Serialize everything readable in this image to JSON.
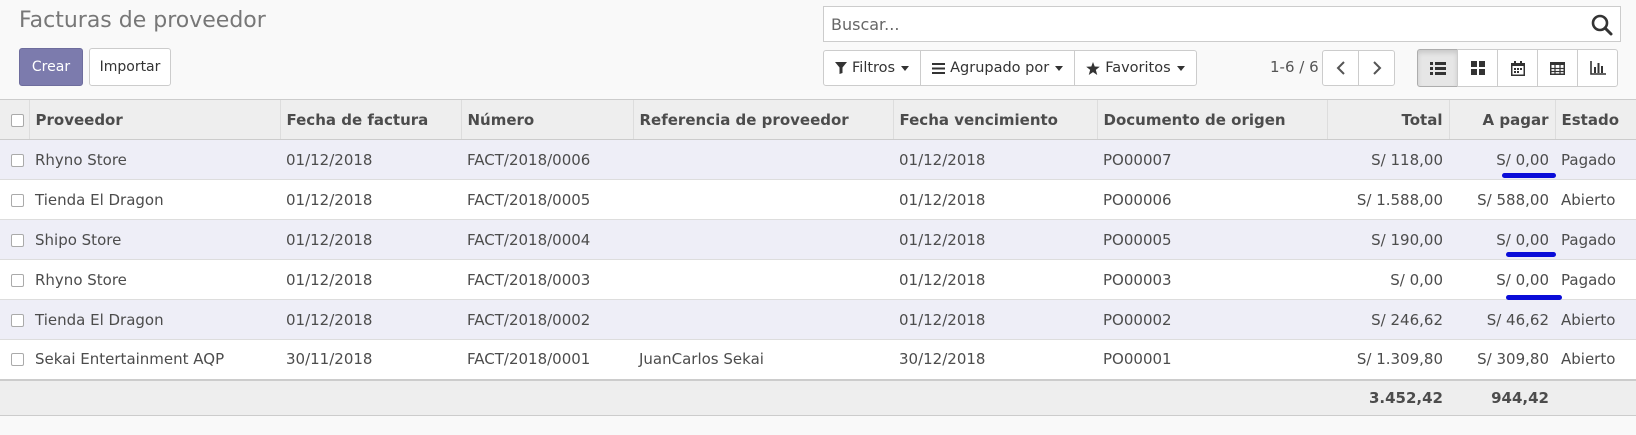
{
  "page": {
    "title": "Facturas de proveedor"
  },
  "buttons": {
    "create": "Crear",
    "import": "Importar"
  },
  "search": {
    "placeholder": "Buscar..."
  },
  "filters": {
    "filter": "Filtros",
    "group_by": "Agrupado por",
    "favorites": "Favoritos"
  },
  "pager": {
    "value": "1-6 / 6"
  },
  "views": [
    "list-view",
    "kanban-view",
    "calendar-view",
    "pivot-view",
    "graph-view"
  ],
  "table": {
    "columns": [
      "Proveedor",
      "Fecha de factura",
      "Número",
      "Referencia de proveedor",
      "Fecha vencimiento",
      "Documento de origen",
      "Total",
      "A pagar",
      "Estado"
    ],
    "rows": [
      [
        "Rhyno Store",
        "01/12/2018",
        "FACT/2018/0006",
        "",
        "01/12/2018",
        "PO00007",
        "S/ 118,00",
        "S/ 0,00",
        "Pagado"
      ],
      [
        "Tienda El Dragon",
        "01/12/2018",
        "FACT/2018/0005",
        "",
        "01/12/2018",
        "PO00006",
        "S/ 1.588,00",
        "S/ 588,00",
        "Abierto"
      ],
      [
        "Shipo Store",
        "01/12/2018",
        "FACT/2018/0004",
        "",
        "01/12/2018",
        "PO00005",
        "S/ 190,00",
        "S/ 0,00",
        "Pagado"
      ],
      [
        "Rhyno Store",
        "01/12/2018",
        "FACT/2018/0003",
        "",
        "01/12/2018",
        "PO00003",
        "S/ 0,00",
        "S/ 0,00",
        "Pagado"
      ],
      [
        "Tienda El Dragon",
        "01/12/2018",
        "FACT/2018/0002",
        "",
        "01/12/2018",
        "PO00002",
        "S/ 246,62",
        "S/ 46,62",
        "Abierto"
      ],
      [
        "Sekai Entertainment AQP",
        "30/11/2018",
        "FACT/2018/0001",
        "JuanCarlos Sekai",
        "30/12/2018",
        "PO00001",
        "S/ 1.309,80",
        "S/ 309,80",
        "Abierto"
      ]
    ],
    "totals": {
      "total": "3.452,42",
      "to_pay": "944,42"
    }
  },
  "colors": {
    "primary": "#7c7bad",
    "annotation": "#0a0cd8",
    "row_odd": "#eeeef7"
  }
}
